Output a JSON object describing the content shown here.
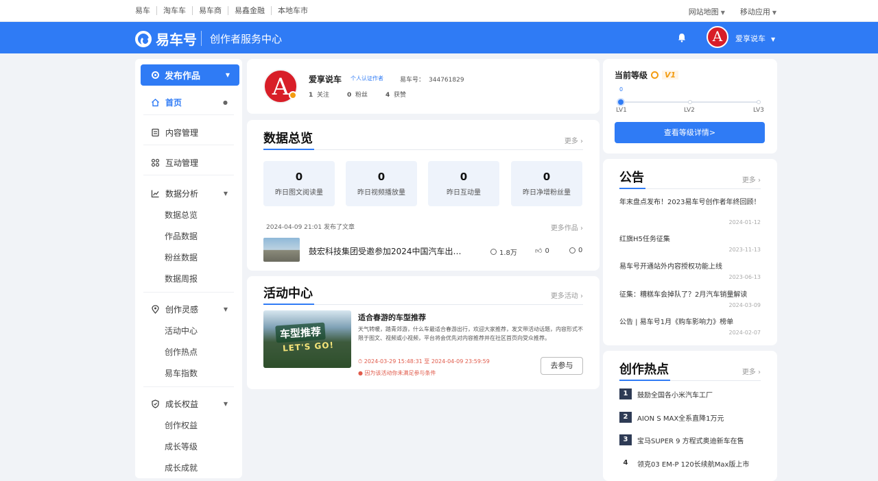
{
  "topbar": {
    "links": [
      "易车",
      "淘车车",
      "易车商",
      "易鑫金融",
      "本地车市"
    ],
    "site_nav": "网站地图",
    "mobile": "移动应用"
  },
  "header": {
    "logo_text": "易车号",
    "center_name": "创作者服务中心",
    "avatar_letter": "A",
    "username": "爱享说车"
  },
  "sidebar": {
    "publish": "发布作品",
    "home": "首页",
    "content_mgmt": "内容管理",
    "interaction_mgmt": "互动管理",
    "data_analysis": "数据分析",
    "data_subs": [
      "数据总览",
      "作品数据",
      "粉丝数据",
      "数据周报"
    ],
    "inspiration": "创作灵感",
    "inspiration_subs": [
      "活动中心",
      "创作热点",
      "易车指数"
    ],
    "growth": "成长权益",
    "growth_subs": [
      "创作权益",
      "成长等级",
      "成长成就"
    ]
  },
  "profile": {
    "avatar_letter": "A",
    "name": "爱享说车",
    "tag": "个人认证作者",
    "id_label": "易车号：",
    "id_value": "344761829",
    "stats": [
      {
        "num": "1",
        "label": "关注"
      },
      {
        "num": "0",
        "label": "粉丝"
      },
      {
        "num": "4",
        "label": "获赞"
      }
    ]
  },
  "overview": {
    "title": "数据总览",
    "more": "更多",
    "stats": [
      {
        "num": "0",
        "label": "昨日图文阅读量"
      },
      {
        "num": "0",
        "label": "昨日视频播放量"
      },
      {
        "num": "0",
        "label": "昨日互动量"
      },
      {
        "num": "0",
        "label": "昨日净增粉丝量"
      }
    ],
    "recent_line": "2024-04-09 21:01 发布了文章",
    "recent_more": "更多作品",
    "article_title": "鼓宏科技集团受邀参加2024中国汽车出…",
    "views": "1.8万",
    "likes": "0",
    "comments": "0"
  },
  "activity": {
    "title": "活动中心",
    "more": "更多活动",
    "img_tag": "车型推荐",
    "img_tag2": "LET'S GO!",
    "name": "适合春游的车型推荐",
    "desc": "天气转暖，踏青郊游，什么车最适合春游出行，欢迎大家推荐，发文带活动话题，内容形式不限于图文、视频或小视频，平台将会优先对内容推荐并在社区首页向受众推荐。",
    "period": "2024-03-29 15:48:31 至 2024-04-09 23:59:59",
    "notice": "因为该活动你未满足参与条件",
    "join": "去参与"
  },
  "level": {
    "title": "当前等级",
    "level_badge": "V1",
    "progress_value": "0",
    "progress_fraction": 0.02,
    "marks": [
      "LV1",
      "LV2",
      "LV3"
    ],
    "button": "查看等级详情>"
  },
  "announcements": {
    "title": "公告",
    "more": "更多",
    "items": [
      {
        "text": "年末盘点发布！2023易车号创作者年终回顾！",
        "date": "2024-01-12"
      },
      {
        "text": "红旗H5任务征集",
        "date": "2023-11-13"
      },
      {
        "text": "易车号开通站外内容授权功能上线",
        "date": "2023-06-13"
      },
      {
        "text": "征集：糟糕车会掉队了？2月汽车销量解读",
        "date": "2024-03-09"
      },
      {
        "text": "公告 | 易车号1月《购车影响力》榜单",
        "date": "2024-02-07"
      }
    ]
  },
  "hot": {
    "title": "创作热点",
    "more": "更多",
    "items": [
      {
        "rank": "1",
        "text": "鼓励全国各小米汽车工厂"
      },
      {
        "rank": "2",
        "text": "AION S MAX全系直降1万元"
      },
      {
        "rank": "3",
        "text": "宝马SUPER 9 方程式奥迪新车在售"
      },
      {
        "rank": "4",
        "text": "领克03 EM-P 120长续航Max版上市"
      }
    ]
  }
}
